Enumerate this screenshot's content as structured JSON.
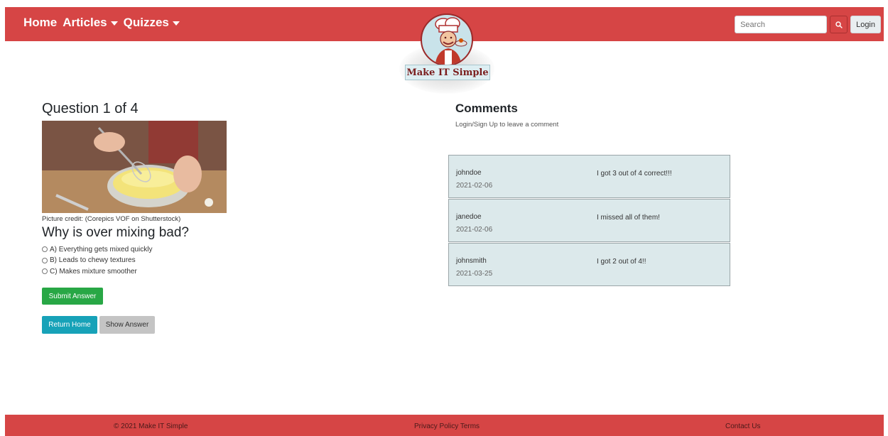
{
  "nav": {
    "home": "Home",
    "articles": "Articles",
    "quizzes": "Quizzes",
    "search_placeholder": "Search",
    "login": "Login",
    "search_icon": "search-icon"
  },
  "logo": {
    "text": "Make IT Simple"
  },
  "quiz": {
    "title": "Question 1 of 4",
    "credit": "Picture credit: (Corepics VOF on Shutterstock)",
    "question": "Why is over mixing bad?",
    "options": [
      "A) Everything gets mixed quickly",
      "B) Leads to chewy textures",
      "C) Makes mixture smoother"
    ],
    "submit": "Submit Answer",
    "return_home": "Return Home",
    "show_answer": "Show Answer"
  },
  "comments": {
    "title": "Comments",
    "login_prompt": "Login/Sign Up to leave a comment",
    "items": [
      {
        "user": "johndoe",
        "date": "2021-02-06",
        "text": "I got 3 out of 4 correct!!!"
      },
      {
        "user": "janedoe",
        "date": "2021-02-06",
        "text": "I missed all of them!"
      },
      {
        "user": "johnsmith",
        "date": "2021-03-25",
        "text": "I got 2 out of 4!!"
      }
    ]
  },
  "footer": {
    "copyright": "© 2021 Make IT Simple",
    "links": "Privacy Policy Terms",
    "contact": "Contact Us"
  },
  "colors": {
    "brand_red": "#d64545",
    "success": "#28a745",
    "info": "#17a2b8",
    "comment_bg": "#dce9eb"
  }
}
